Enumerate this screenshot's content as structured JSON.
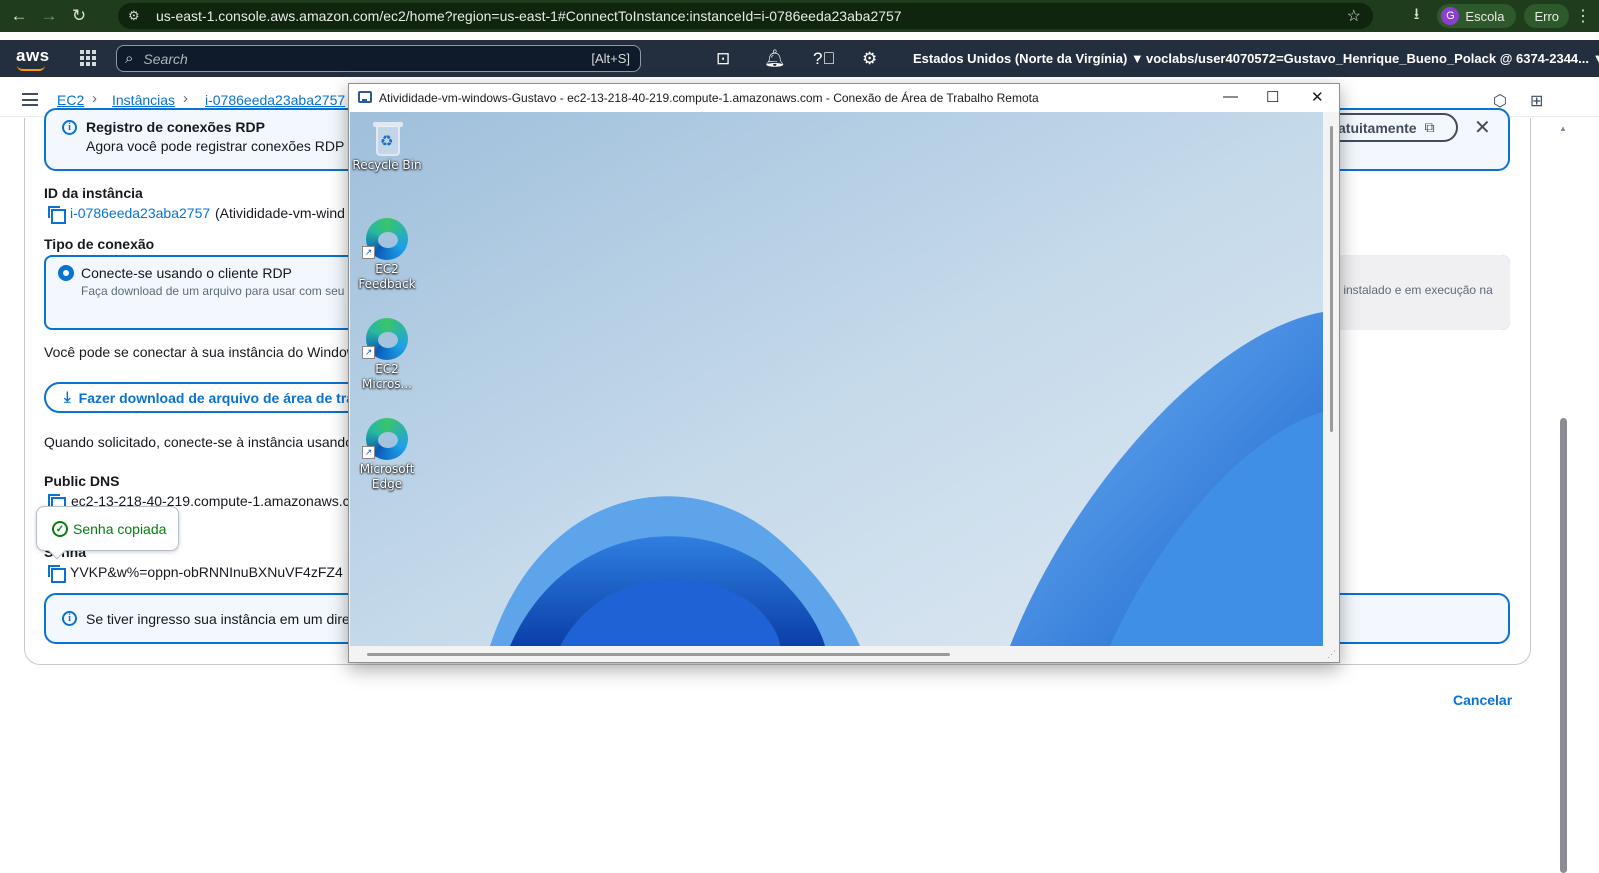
{
  "browser": {
    "url": "us-east-1.console.aws.amazon.com/ec2/home?region=us-east-1#ConnectToInstance:instanceId=i-0786eeda23aba2757",
    "profile_initial": "G",
    "profile_name": "Escola",
    "error_label": "Erro"
  },
  "aws_nav": {
    "logo": "aws",
    "search_placeholder": "Search",
    "search_shortcut": "[Alt+S]",
    "region": "Estados Unidos (Norte da Virgínia) ▼",
    "account": "voclabs/user4070572=Gustavo_Henrique_Bueno_Polack @ 6374-2344... ▼"
  },
  "breadcrumb": {
    "items": [
      "EC2",
      "Instâncias",
      "i-0786eeda23aba2757"
    ]
  },
  "page": {
    "rdp_log_alert": {
      "title": "Registro de conexões RDP",
      "text": "Agora você pode registrar conexões RDP us",
      "button": "atuitamente"
    },
    "instance_id_label": "ID da instância",
    "instance_id_value": "i-0786eeda23aba2757",
    "instance_name": "(Ativididade-vm-wind",
    "connection_type_label": "Tipo de conexão",
    "rdp_option_label": "Conecte-se usando o cliente RDP",
    "rdp_option_desc": "Faça download de um arquivo para usar com seu c",
    "other_option_desc": "r instalado e em execução na",
    "connect_text": "Você pode se conectar à sua instância do Window",
    "download_button": "Fazer download de arquivo de área de tra",
    "prompt_text": "Quando solicitado, conecte-se à instância usando",
    "public_dns_label": "Public DNS",
    "public_dns_value": "ec2-13-218-40-219.compute-1.amazonaws.c",
    "password_label": "Senha",
    "password_value": "YVKP&w%=oppn-obRNNInuBXNuVF4zFZ4",
    "domain_alert_text": "Se tiver ingresso sua instância em um diret",
    "cancel": "Cancelar"
  },
  "toast": {
    "text": "Senha copiada"
  },
  "rdp_window": {
    "title": "Ativididade-vm-windows-Gustavo - ec2-13-218-40-219.compute-1.amazonaws.com - Conexão de Área de Trabalho Remota",
    "minimize": "—",
    "maximize": "☐",
    "close": "✕",
    "desktop_icons": [
      {
        "label": "Recycle Bin"
      },
      {
        "label": "EC2 Feedback"
      },
      {
        "label": "EC2 Micros..."
      },
      {
        "label": "Microsoft Edge"
      }
    ]
  },
  "colors": {
    "browser_bar": "#1f3d1d",
    "aws_nav": "#232f3e",
    "link_blue": "#0972d3",
    "success_green": "#037f0c"
  }
}
